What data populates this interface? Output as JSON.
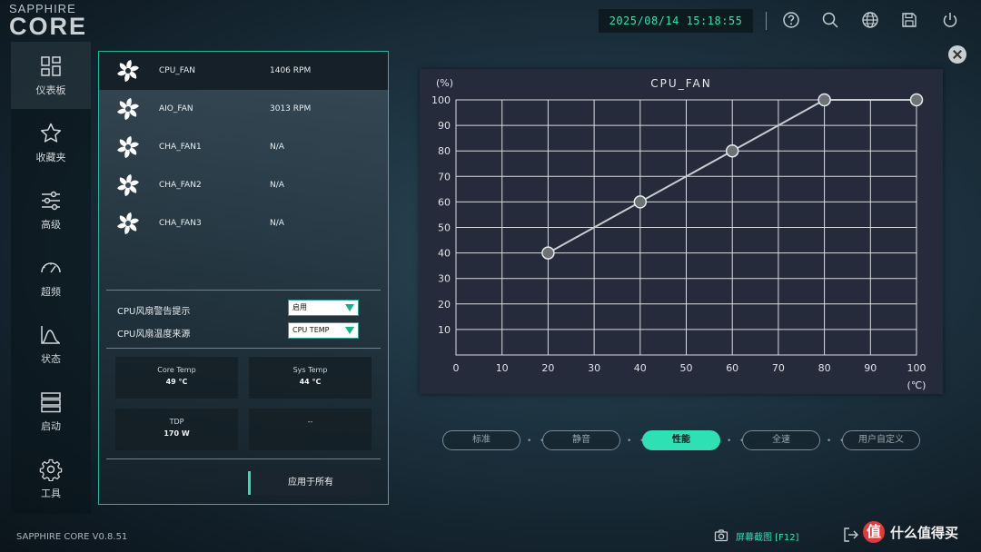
{
  "app": {
    "logo_top": "SAPPHIRE",
    "logo_main": "CORE",
    "version": "SAPPHIRE CORE V0.8.51"
  },
  "header": {
    "datetime": "2025/08/14 15:18:55",
    "icons": [
      "help-icon",
      "search-icon",
      "globe-icon",
      "save-icon",
      "power-icon"
    ]
  },
  "sidebar": {
    "items": [
      {
        "label": "仪表板",
        "icon": "dashboard-icon",
        "active": true
      },
      {
        "label": "收藏夹",
        "icon": "star-icon"
      },
      {
        "label": "高级",
        "icon": "sliders-icon"
      },
      {
        "label": "超频",
        "icon": "gauge-icon"
      },
      {
        "label": "状态",
        "icon": "status-chart-icon"
      },
      {
        "label": "启动",
        "icon": "server-icon"
      },
      {
        "label": "工具",
        "icon": "gear-icon"
      }
    ]
  },
  "fans": [
    {
      "name": "CPU_FAN",
      "rpm": "1406 RPM",
      "active": true
    },
    {
      "name": "AIO_FAN",
      "rpm": "3013 RPM"
    },
    {
      "name": "CHA_FAN1",
      "rpm": "N/A"
    },
    {
      "name": "CHA_FAN2",
      "rpm": "N/A"
    },
    {
      "name": "CHA_FAN3",
      "rpm": "N/A"
    }
  ],
  "options": {
    "warning_label": "CPU风扇警告提示",
    "warning_value": "启用",
    "source_label": "CPU风扇温度来源",
    "source_value": "CPU TEMP"
  },
  "stats": {
    "core_temp_label": "Core Temp",
    "core_temp_value": "49 °C",
    "sys_temp_label": "Sys Temp",
    "sys_temp_value": "44 °C",
    "tdp_label": "TDP",
    "tdp_value": "170 W",
    "empty_value": "--"
  },
  "apply_label": "应用于所有",
  "modes": [
    {
      "label": "标准"
    },
    {
      "label": "静音"
    },
    {
      "label": "性能",
      "active": true
    },
    {
      "label": "全速"
    },
    {
      "label": "用户自定义"
    }
  ],
  "footer": {
    "screenshot_label": "屏幕截图 [F12]",
    "watermark_symbol": "值",
    "watermark_text": "什么值得买"
  },
  "colors": {
    "accent": "#2fe0b5",
    "chart_bg": "#262b3b",
    "grid": "#d8dbe0"
  },
  "chart_data": {
    "type": "line",
    "title": "CPU_FAN",
    "ylabel": "(%)",
    "xlabel": "(℃)",
    "x_ticks": [
      0,
      10,
      20,
      30,
      40,
      50,
      60,
      70,
      80,
      90,
      100
    ],
    "y_ticks": [
      10,
      20,
      30,
      40,
      50,
      60,
      70,
      80,
      90,
      100
    ],
    "xlim": [
      0,
      100
    ],
    "ylim": [
      0,
      100
    ],
    "grid": true,
    "series": [
      {
        "x": [
          20,
          40,
          60,
          80,
          100
        ],
        "y": [
          40,
          60,
          80,
          100,
          100
        ]
      }
    ]
  }
}
